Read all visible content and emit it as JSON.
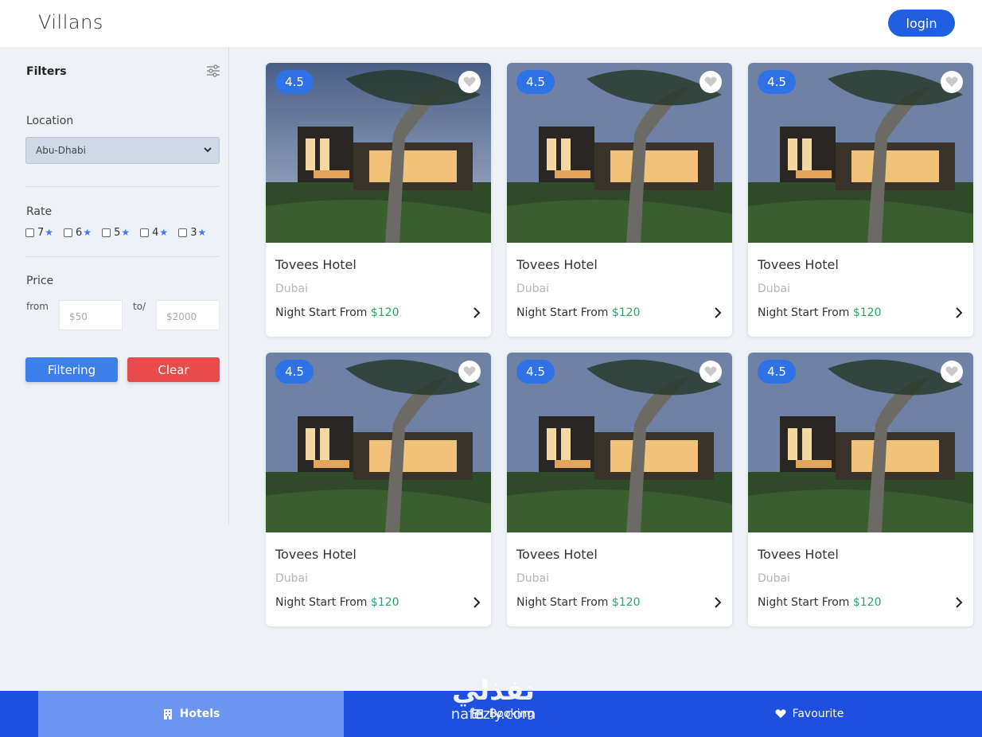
{
  "header": {
    "brand": "Villans",
    "login_label": "login"
  },
  "filters": {
    "title": "Filters",
    "location_label": "Location",
    "location_value": "Abu-Dhabi",
    "rate_label": "Rate",
    "rate_options": [
      "7",
      "6",
      "5",
      "4",
      "3"
    ],
    "price_label": "Price",
    "from_label": "from",
    "to_label": "to/",
    "from_placeholder": "$50",
    "to_placeholder": "$2000",
    "filter_button": "Filtering",
    "clear_button": "Clear"
  },
  "hotels": [
    {
      "rating": "4.5",
      "name": "Tovees Hotel",
      "city": "Dubai",
      "price_prefix": "Night Start From ",
      "price": "$120"
    },
    {
      "rating": "4.5",
      "name": "Tovees Hotel",
      "city": "Dubai",
      "price_prefix": "Night Start From ",
      "price": "$120"
    },
    {
      "rating": "4.5",
      "name": "Tovees Hotel",
      "city": "Dubai",
      "price_prefix": "Night Start From ",
      "price": "$120"
    },
    {
      "rating": "4.5",
      "name": "Tovees Hotel",
      "city": "Dubai",
      "price_prefix": "Night Start From ",
      "price": "$120"
    },
    {
      "rating": "4.5",
      "name": "Tovees Hotel",
      "city": "Dubai",
      "price_prefix": "Night Start From ",
      "price": "$120"
    },
    {
      "rating": "4.5",
      "name": "Tovees Hotel",
      "city": "Dubai",
      "price_prefix": "Night Start From ",
      "price": "$120"
    }
  ],
  "bottom_nav": {
    "hotels": "Hotels",
    "booking": "Booking",
    "favourite": "Favourite"
  },
  "watermark": {
    "arabic": "نفذلي",
    "latin": "nafezly.com"
  },
  "colors": {
    "primary": "#1f4fe0",
    "accent_green": "#2aa36b",
    "clear_red": "#e84b4b",
    "rating_blue": "#2f72e6"
  }
}
